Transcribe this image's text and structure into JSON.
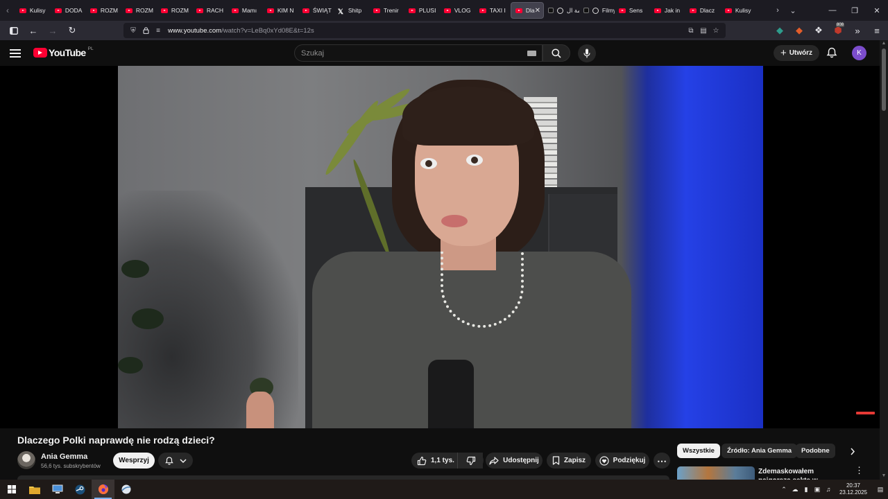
{
  "browser": {
    "tabs": [
      {
        "label": "Kulisy",
        "icon": "youtube",
        "active": false
      },
      {
        "label": "DODA",
        "icon": "youtube",
        "active": false
      },
      {
        "label": "ROZM",
        "icon": "youtube",
        "active": false
      },
      {
        "label": "ROZM",
        "icon": "youtube",
        "active": false
      },
      {
        "label": "ROZM",
        "icon": "youtube",
        "active": false
      },
      {
        "label": "RACH",
        "icon": "youtube",
        "active": false
      },
      {
        "label": "Mamı",
        "icon": "youtube",
        "active": false
      },
      {
        "label": "KIM N",
        "icon": "youtube",
        "active": false
      },
      {
        "label": "ŚWIĄT",
        "icon": "youtube",
        "active": false
      },
      {
        "label": "Shitp",
        "icon": "x",
        "active": false
      },
      {
        "label": "Trenir",
        "icon": "youtube",
        "active": false
      },
      {
        "label": "PLUSI",
        "icon": "youtube",
        "active": false
      },
      {
        "label": "VLOG",
        "icon": "youtube",
        "active": false
      },
      {
        "label": "TAXI I",
        "icon": "youtube",
        "active": false
      },
      {
        "label": "Dla",
        "icon": "youtube",
        "active": true
      },
      {
        "label": "لقمة ال",
        "icon": "tiktok-play",
        "active": false
      },
      {
        "label": "Filmy",
        "icon": "tiktok-play",
        "active": false
      },
      {
        "label": "Sens",
        "icon": "youtube",
        "active": false
      },
      {
        "label": "Jak in",
        "icon": "youtube",
        "active": false
      },
      {
        "label": "Dlacz",
        "icon": "youtube",
        "active": false
      },
      {
        "label": "Kulisy",
        "icon": "youtube",
        "active": false
      }
    ],
    "url_host": "www.youtube.com",
    "url_path": "/watch?v=LeBq0xYd08E&t=12s",
    "extension_badge": "808"
  },
  "youtube": {
    "logo_text": "YouTube",
    "country_code": "PL",
    "search_placeholder": "Szukaj",
    "create_label": "Utwórz",
    "avatar_letter": "K",
    "accent_color": "#ff0033"
  },
  "video": {
    "title": "Dlaczego Polki naprawdę nie rodzą dzieci?",
    "channel_name": "Ania Gemma",
    "subscribers": "56,6 tys. subskrybentów",
    "support_label": "Wesprzyj",
    "likes": "1,1 tys.",
    "share_label": "Udostępnij",
    "save_label": "Zapisz",
    "thanks_label": "Podziękuj"
  },
  "sidebar": {
    "chips": [
      "Wszystkie",
      "Źródło: Ania Gemma",
      "Podobne"
    ],
    "selected_chip": "Wszystkie",
    "recommendation_title": "Zdemaskowałem najgorszą sektę w Ameryce"
  },
  "taskbar": {
    "time": "20:37",
    "date": "23.12.2025"
  }
}
